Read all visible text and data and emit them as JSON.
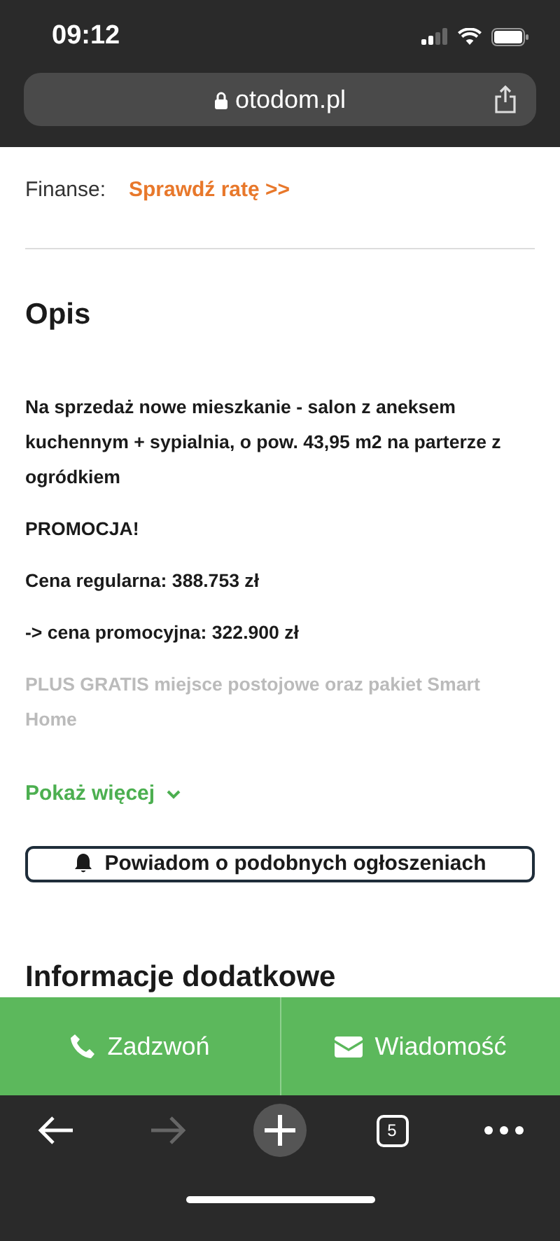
{
  "status_bar": {
    "time": "09:12"
  },
  "address_bar": {
    "url": "otodom.pl"
  },
  "finance": {
    "label": "Finanse:",
    "link": "Sprawdź ratę >>"
  },
  "description": {
    "heading": "Opis",
    "paragraphs": [
      {
        "text": "Na sprzedaż nowe mieszkanie - salon z aneksem kuchennym + sypialnia, o pow. 43,95 m2 na parterze z ogródkiem",
        "faded": false
      },
      {
        "text": "PROMOCJA!",
        "faded": false
      },
      {
        "text": "Cena regularna: 388.753 zł",
        "faded": false
      },
      {
        "text": "-> cena promocyjna: 322.900 zł",
        "faded": false
      },
      {
        "text": "PLUS GRATIS miejsce postojowe oraz pakiet Smart Home",
        "faded": true
      }
    ],
    "show_more": "Pokaż więcej"
  },
  "alert_button": "Powiadom o podobnych ogłoszeniach",
  "next_heading": "Informacje dodatkowe",
  "actions": [
    {
      "kind": "call",
      "label": "Zadzwoń"
    },
    {
      "kind": "message",
      "label": "Wiadomość"
    }
  ],
  "toolbar": [
    {
      "kind": "back",
      "disabled": false
    },
    {
      "kind": "forward",
      "disabled": true
    },
    {
      "kind": "new_tab",
      "disabled": false
    },
    {
      "kind": "tabs",
      "count": "5",
      "disabled": false
    },
    {
      "kind": "more",
      "disabled": false
    }
  ]
}
